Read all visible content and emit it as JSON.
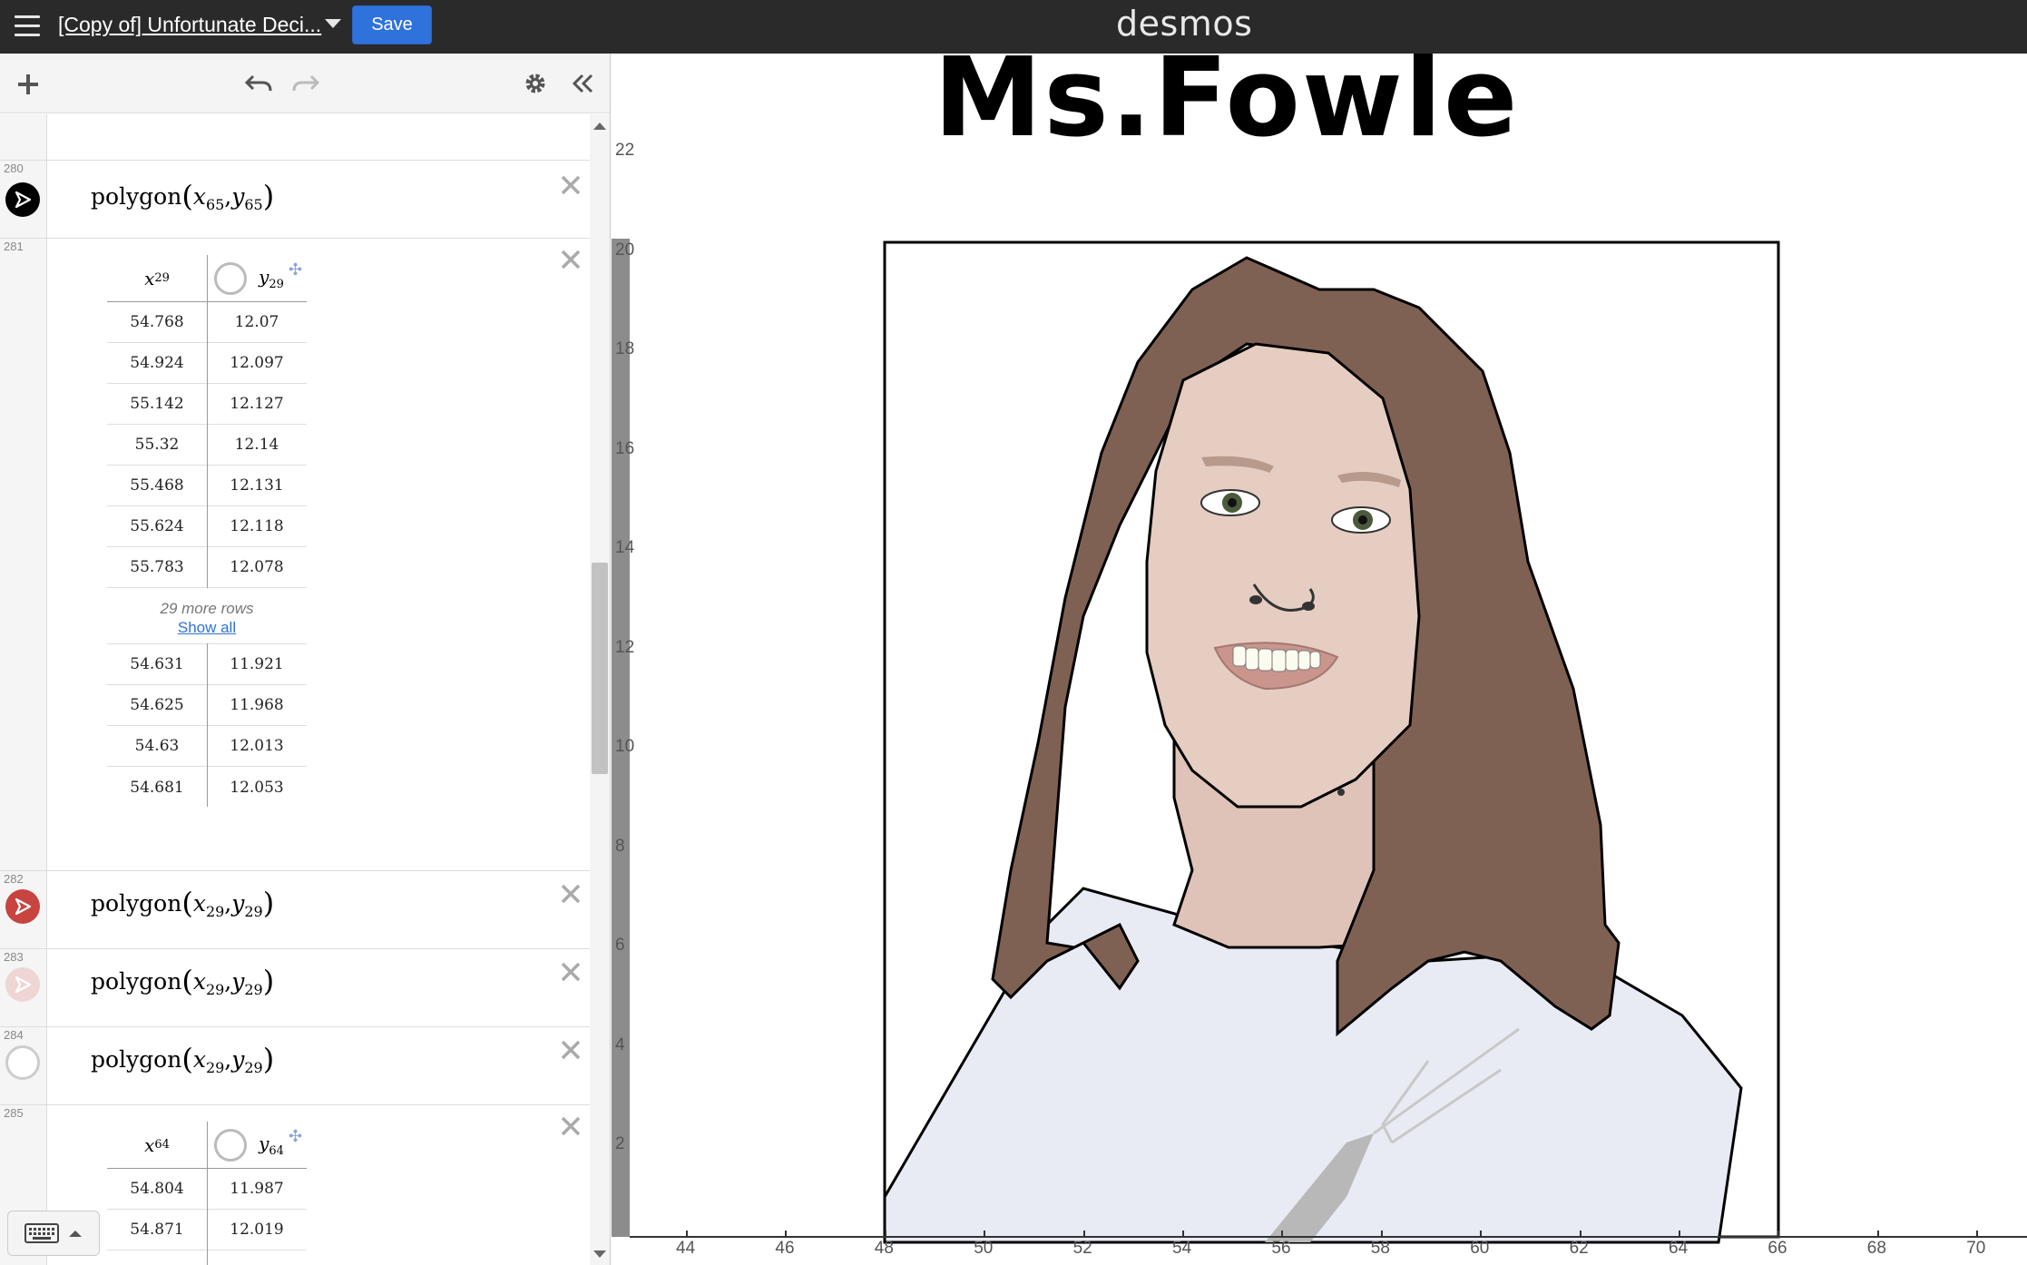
{
  "topbar": {
    "graph_title": "[Copy of] Unfortunate Deci...",
    "save_label": "Save",
    "logo": "desmos"
  },
  "graph": {
    "title_text": "Ms.Fowle",
    "y_ticks": [
      "22",
      "20",
      "18",
      "16",
      "14",
      "12",
      "10",
      "8",
      "6",
      "4",
      "2"
    ],
    "x_ticks": [
      "44",
      "46",
      "48",
      "50",
      "52",
      "54",
      "56",
      "58",
      "60",
      "62",
      "64",
      "66",
      "68",
      "70"
    ]
  },
  "expressions": [
    {
      "num": "280",
      "fn": "polygon",
      "x": "x",
      "xsub": "65",
      "y": "y",
      "ysub": "65",
      "color": "#000000"
    },
    {
      "num": "281",
      "table": {
        "x_header": "x",
        "x_sub": "29",
        "y_header": "y",
        "y_sub": "29",
        "top_rows": [
          [
            "54.768",
            "12.07"
          ],
          [
            "54.924",
            "12.097"
          ],
          [
            "55.142",
            "12.127"
          ],
          [
            "55.32",
            "12.14"
          ],
          [
            "55.468",
            "12.131"
          ],
          [
            "55.624",
            "12.118"
          ],
          [
            "55.783",
            "12.078"
          ]
        ],
        "more_rows": "29 more rows",
        "show_all": "Show all",
        "bottom_rows": [
          [
            "54.631",
            "11.921"
          ],
          [
            "54.625",
            "11.968"
          ],
          [
            "54.63",
            "12.013"
          ],
          [
            "54.681",
            "12.053"
          ]
        ]
      }
    },
    {
      "num": "282",
      "fn": "polygon",
      "x": "x",
      "xsub": "29",
      "y": "y",
      "ysub": "29",
      "color": "#c74440"
    },
    {
      "num": "283",
      "fn": "polygon",
      "x": "x",
      "xsub": "29",
      "y": "y",
      "ysub": "29",
      "color": "#e8b8b8"
    },
    {
      "num": "284",
      "fn": "polygon",
      "x": "x",
      "xsub": "29",
      "y": "y",
      "ysub": "29",
      "color": "#ffffff"
    },
    {
      "num": "285",
      "table": {
        "x_header": "x",
        "x_sub": "64",
        "y_header": "y",
        "y_sub": "64",
        "top_rows": [
          [
            "54.804",
            "11.987"
          ],
          [
            "54.871",
            "12.019"
          ]
        ]
      }
    }
  ],
  "colors": {
    "topbar_bg": "#2a2a2a",
    "save_blue": "#2f72dc",
    "hair": "#7f6154",
    "skin": "#e6cdc1",
    "shirt": "#e8eaf4"
  }
}
